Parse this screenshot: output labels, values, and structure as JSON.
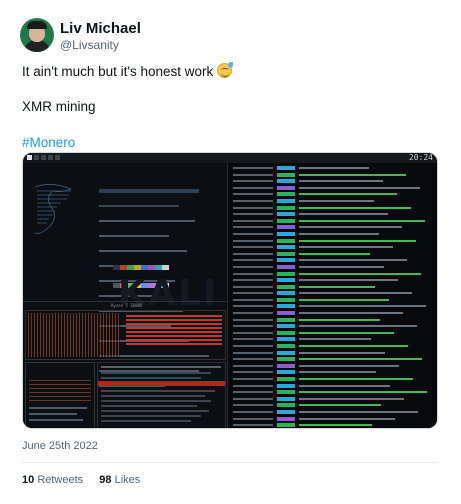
{
  "author": {
    "name": "Liv Michael",
    "handle": "@Livsanity",
    "avatar_icon": "profile-photo"
  },
  "tweet": {
    "line1": "It ain't much but it's honest work",
    "line1_emoji": "grinning-face-with-sweat-emoji",
    "line2": "XMR mining",
    "hashtag": "#Monero",
    "date": "June 25th 2022"
  },
  "engagement": {
    "retweets_count": "10",
    "retweets_label": "Retweets",
    "likes_count": "98",
    "likes_label": "Likes"
  },
  "screenshot": {
    "clock": "20:24",
    "watermark": "KALI",
    "btop_title": "Ryzen 5 3600U",
    "log_levels": [
      "net",
      "cpu",
      "net",
      "miner",
      "cpu",
      "net",
      "cpu",
      "net",
      "cpu",
      "miner",
      "net",
      "cpu",
      "net",
      "cpu",
      "net",
      "miner",
      "cpu",
      "net",
      "cpu",
      "net",
      "cpu",
      "net",
      "miner",
      "cpu",
      "net",
      "cpu",
      "net",
      "cpu",
      "net",
      "cpu",
      "miner",
      "net",
      "cpu",
      "net",
      "cpu",
      "net",
      "cpu",
      "net",
      "miner",
      "cpu"
    ],
    "colors": {
      "net_tag": "#2aa8d8",
      "cpu_tag": "#29b35a",
      "miner_tag": "#8e5bd0",
      "hashtag": "#1d9bf0"
    }
  }
}
